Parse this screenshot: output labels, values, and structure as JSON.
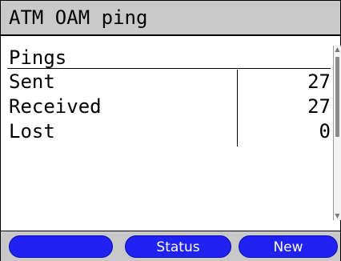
{
  "window": {
    "title": "ATM OAM ping"
  },
  "pings": {
    "section_label": "Pings",
    "rows": [
      {
        "label": "Sent",
        "value": "27"
      },
      {
        "label": "Received",
        "value": "27"
      },
      {
        "label": "Lost",
        "value": "0"
      }
    ]
  },
  "scrollbar": {
    "up_icon": "scroll-up-arrow",
    "down_icon": "scroll-down-arrow"
  },
  "softkeys": [
    {
      "label": ""
    },
    {
      "label": "Status"
    },
    {
      "label": "New"
    }
  ],
  "colors": {
    "title_bg": "#c9c9c9",
    "softkey_bg": "#1f22f0",
    "softkey_text": "#ffffff"
  }
}
